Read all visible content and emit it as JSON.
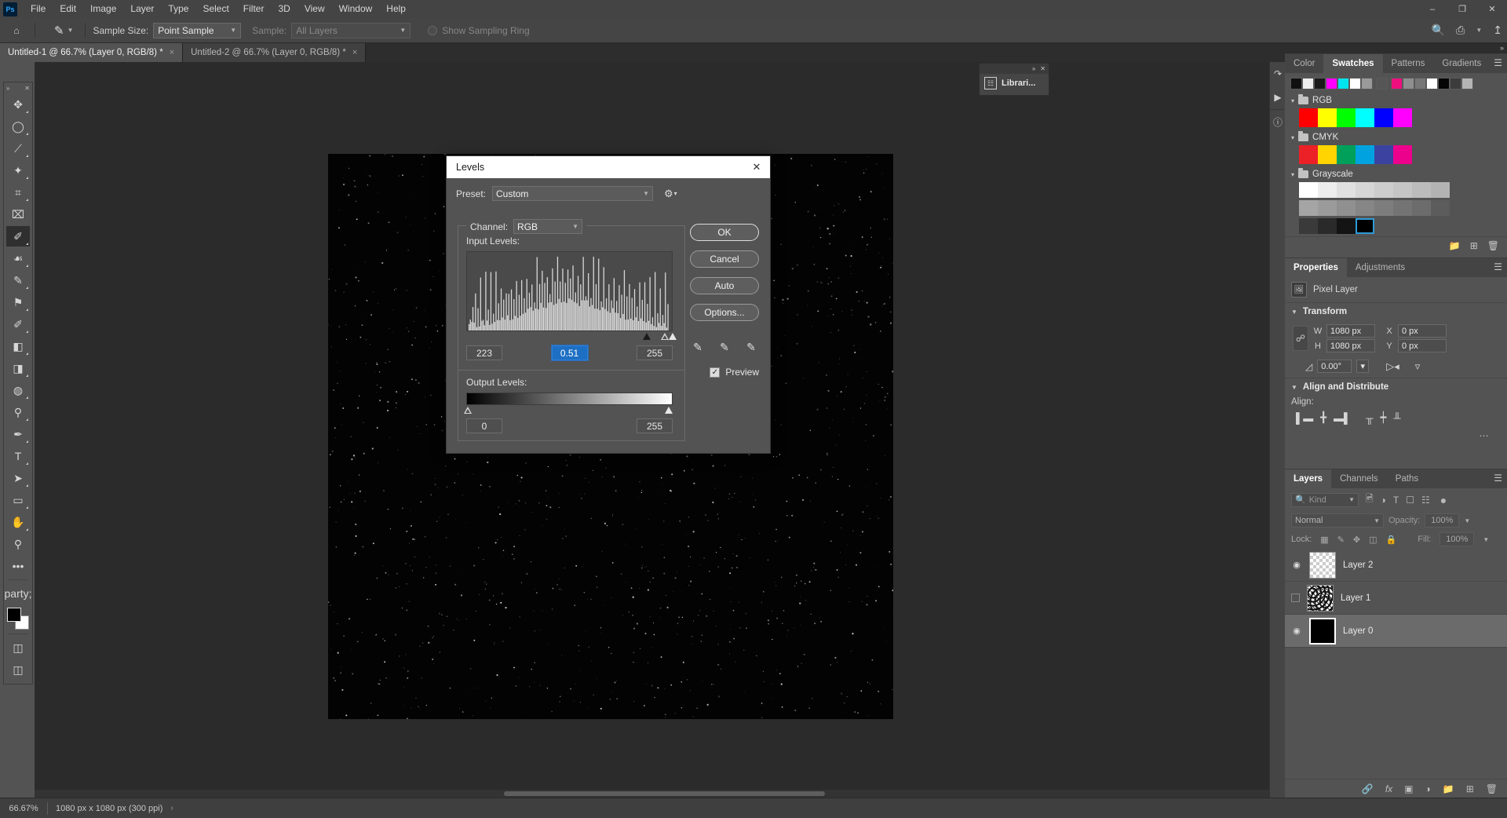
{
  "app": {
    "name": "Photoshop",
    "logo_text": "Ps"
  },
  "menubar": {
    "items": [
      "File",
      "Edit",
      "Image",
      "Layer",
      "Type",
      "Select",
      "Filter",
      "3D",
      "View",
      "Window",
      "Help"
    ],
    "window_controls": [
      "minimize-icon",
      "maximize-icon",
      "close-icon"
    ]
  },
  "options_bar": {
    "home_icon": "home-icon",
    "tool_icon": "eyedropper-icon",
    "sample_size_label": "Sample Size:",
    "sample_size_value": "Point Sample",
    "sample_label": "Sample:",
    "sample_value": "All Layers",
    "show_sampling_ring_label": "Show Sampling Ring",
    "right_icons": [
      "search-icon",
      "workspace-icon",
      "share-icon"
    ]
  },
  "tabs": [
    {
      "label": "Untitled-1 @ 66.7% (Layer 0, RGB/8) *",
      "active": true,
      "close": "×"
    },
    {
      "label": "Untitled-2 @ 66.7% (Layer 0, RGB/8) *",
      "active": false,
      "close": "×"
    }
  ],
  "toolbar": {
    "collapse_icon": "»",
    "close_icon": "✕",
    "tools": [
      {
        "name": "move-tool",
        "glyph": "✥",
        "active": false,
        "has_submenu": true
      },
      {
        "name": "elliptical-marquee-tool",
        "glyph": "◯",
        "active": false,
        "has_submenu": true
      },
      {
        "name": "lasso-tool",
        "glyph": "⟋",
        "active": false,
        "has_submenu": true
      },
      {
        "name": "magic-wand-tool",
        "glyph": "✦",
        "active": false,
        "has_submenu": true
      },
      {
        "name": "crop-tool",
        "glyph": "⌗",
        "active": false,
        "has_submenu": true
      },
      {
        "name": "frame-tool",
        "glyph": "⌧",
        "active": false,
        "has_submenu": false
      },
      {
        "name": "eyedropper-tool",
        "glyph": "✐",
        "active": true,
        "has_submenu": true
      },
      {
        "name": "spot-healing-brush-tool",
        "glyph": "☙",
        "active": false,
        "has_submenu": true
      },
      {
        "name": "brush-tool",
        "glyph": "✎",
        "active": false,
        "has_submenu": true
      },
      {
        "name": "clone-stamp-tool",
        "glyph": "⚑",
        "active": false,
        "has_submenu": true
      },
      {
        "name": "history-brush-tool",
        "glyph": "✐",
        "active": false,
        "has_submenu": true
      },
      {
        "name": "eraser-tool",
        "glyph": "◧",
        "active": false,
        "has_submenu": true
      },
      {
        "name": "gradient-tool",
        "glyph": "◨",
        "active": false,
        "has_submenu": true
      },
      {
        "name": "blur-tool",
        "glyph": "◍",
        "active": false,
        "has_submenu": true
      },
      {
        "name": "dodge-tool",
        "glyph": "⚲",
        "active": false,
        "has_submenu": true
      },
      {
        "name": "pen-tool",
        "glyph": "✒",
        "active": false,
        "has_submenu": true
      },
      {
        "name": "type-tool",
        "glyph": "T",
        "active": false,
        "has_submenu": true
      },
      {
        "name": "path-selection-tool",
        "glyph": "➤",
        "active": false,
        "has_submenu": true
      },
      {
        "name": "rectangle-tool",
        "glyph": "▭",
        "active": false,
        "has_submenu": true
      },
      {
        "name": "hand-tool",
        "glyph": "✋",
        "active": false,
        "has_submenu": true
      },
      {
        "name": "zoom-tool",
        "glyph": "⚲",
        "active": false,
        "has_submenu": false
      },
      {
        "name": "edit-toolbar-button",
        "glyph": "•••",
        "active": false,
        "has_submenu": false
      }
    ],
    "foreground_color": "#000000",
    "background_color": "#ffffff",
    "quick_mask_icon": "quick-mask-icon",
    "screen_mode_icon": "screen-mode-icon"
  },
  "canvas": {
    "document_background": "#030303"
  },
  "libraries_panel": {
    "title": "Librari...",
    "collapse_icon": "»",
    "close_icon": "✕",
    "icon": "libraries-icon"
  },
  "rail": {
    "icons": [
      "history-icon",
      "play-icon",
      "info-icon"
    ]
  },
  "swatches_panel": {
    "tabs": [
      "Color",
      "Swatches",
      "Patterns",
      "Gradients"
    ],
    "active_tab": "Swatches",
    "menu_icon": "panel-menu-icon",
    "recent": [
      "#111111",
      "#eeeeee",
      "#1a1a1a",
      "#ff00ff",
      "#00e5ef",
      "#ffffff",
      "#9a9a9a",
      "#565656",
      "#ee0f7e",
      "#8e8e8e",
      "#777777",
      "#ffffff",
      "#050505",
      "#3c3c3c",
      "#b4b4b4"
    ],
    "groups": [
      {
        "name": "RGB",
        "colors": [
          "#ff0000",
          "#ffff00",
          "#00ff00",
          "#00ffff",
          "#0000ff",
          "#ff00ff"
        ]
      },
      {
        "name": "CMYK",
        "colors": [
          "#ec2027",
          "#ffd400",
          "#00a05a",
          "#00a3e0",
          "#3b42a0",
          "#ec018c"
        ]
      },
      {
        "name": "Grayscale",
        "colors": [
          "#ffffff",
          "#ededed",
          "#e0e0e0",
          "#d6d6d6",
          "#cdcdcd",
          "#c5c5c5",
          "#bcbcbc",
          "#b3b3b3",
          "#a5a5a5",
          "#9b9b9b",
          "#909090",
          "#868686",
          "#7d7d7d",
          "#747474",
          "#6c6c6c",
          "#5c5c5c",
          "#3a3a3a",
          "#2a2a2a",
          "#141414",
          "#000000"
        ],
        "selected_index": 19
      }
    ],
    "footer_icons": [
      "new-group-icon",
      "new-swatch-icon",
      "delete-icon"
    ]
  },
  "properties_panel": {
    "tabs": [
      "Properties",
      "Adjustments"
    ],
    "active_tab": "Properties",
    "menu_icon": "panel-menu-icon",
    "layer_kind_icon": "pixel-layer-icon",
    "layer_kind": "Pixel Layer",
    "transform": {
      "title": "Transform",
      "link_icon": "link-aspect-icon",
      "w_label": "W",
      "w_value": "1080 px",
      "h_label": "H",
      "h_value": "1080 px",
      "x_label": "X",
      "x_value": "0 px",
      "y_label": "Y",
      "y_value": "0 px",
      "angle_icon": "angle-icon",
      "angle_value": "0.00°",
      "flip_horizontal_icon": "flip-horizontal-icon",
      "flip_vertical_icon": "flip-vertical-icon"
    },
    "align": {
      "title": "Align and Distribute",
      "label": "Align:",
      "icons": [
        "align-left-icon",
        "align-center-horizontal-icon",
        "align-right-icon",
        "align-top-icon",
        "align-middle-vertical-icon",
        "align-bottom-icon"
      ],
      "more_icon": "more-options-icon"
    }
  },
  "layers_panel": {
    "tabs": [
      "Layers",
      "Channels",
      "Paths"
    ],
    "active_tab": "Layers",
    "menu_icon": "panel-menu-icon",
    "filter_placeholder": "Kind",
    "filter_icons": [
      "filter-image-icon",
      "filter-adjustment-icon",
      "filter-type-icon",
      "filter-shape-icon",
      "filter-smart-object-icon"
    ],
    "filter_toggle_icon": "filter-toggle-icon",
    "blend_mode": "Normal",
    "opacity_label": "Opacity:",
    "opacity_value": "100%",
    "lock_label": "Lock:",
    "lock_icons": [
      "lock-transparent-pixels-icon",
      "lock-image-pixels-icon",
      "lock-position-icon",
      "lock-artboard-icon",
      "lock-all-icon"
    ],
    "fill_label": "Fill:",
    "fill_value": "100%",
    "layers": [
      {
        "name": "Layer 2",
        "visible": true,
        "selected": false,
        "thumb": "checker"
      },
      {
        "name": "Layer 1",
        "visible": false,
        "selected": false,
        "thumb": "noise"
      },
      {
        "name": "Layer 0",
        "visible": true,
        "selected": true,
        "thumb": "black"
      }
    ],
    "footer_icons": [
      "link-layers-icon",
      "layer-style-fx-icon",
      "add-layer-mask-icon",
      "new-adjustment-layer-icon",
      "new-group-icon",
      "new-layer-icon",
      "delete-layer-icon"
    ]
  },
  "levels_dialog": {
    "title": "Levels",
    "close_icon": "✕",
    "preset_label": "Preset:",
    "preset_value": "Custom",
    "preset_options_icon": "preset-options-gear-icon",
    "channel_label": "Channel:",
    "channel_value": "RGB",
    "input_levels_label": "Input Levels:",
    "input_black": "223",
    "input_gamma": "0.51",
    "input_white": "255",
    "output_levels_label": "Output Levels:",
    "output_black": "0",
    "output_white": "255",
    "buttons": [
      "OK",
      "Cancel",
      "Auto",
      "Options..."
    ],
    "eyedroppers": [
      "set-black-point-icon",
      "set-gray-point-icon",
      "set-white-point-icon"
    ],
    "preview_label": "Preview",
    "preview_checked": true,
    "selected_field": "input_gamma",
    "histogram": {
      "black_marker_pos_pct": 87.3,
      "gamma_marker_pos_pct": 96.2,
      "white_marker_pos_pct": 100
    }
  },
  "statusbar": {
    "zoom": "66.67%",
    "doc_info": "1080 px x 1080 px (300 ppi)",
    "arrow": "›"
  }
}
